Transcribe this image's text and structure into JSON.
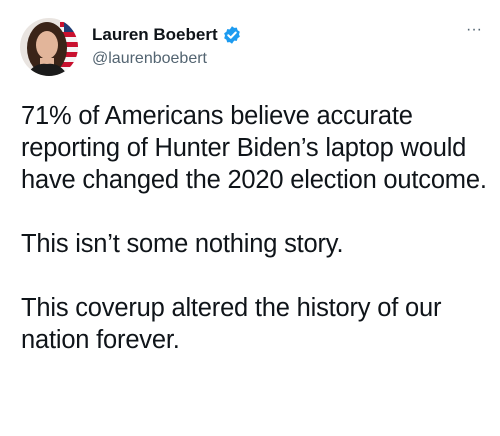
{
  "author": {
    "display_name": "Lauren Boebert",
    "handle": "@laurenboebert",
    "verified": true,
    "avatar_icon": "profile-photo"
  },
  "menu": {
    "more_label": "···",
    "more_icon": "more-options-icon"
  },
  "tweet": {
    "paragraphs": [
      "71% of Americans believe accurate reporting of Hunter Biden’s laptop would have changed the 2020 election outcome.",
      "This isn’t some nothing story.",
      "This coverup altered the history of our nation forever."
    ]
  },
  "colors": {
    "text": "#0f1419",
    "secondary": "#536471",
    "verified_badge": "#1d9bf0",
    "background": "#ffffff"
  }
}
